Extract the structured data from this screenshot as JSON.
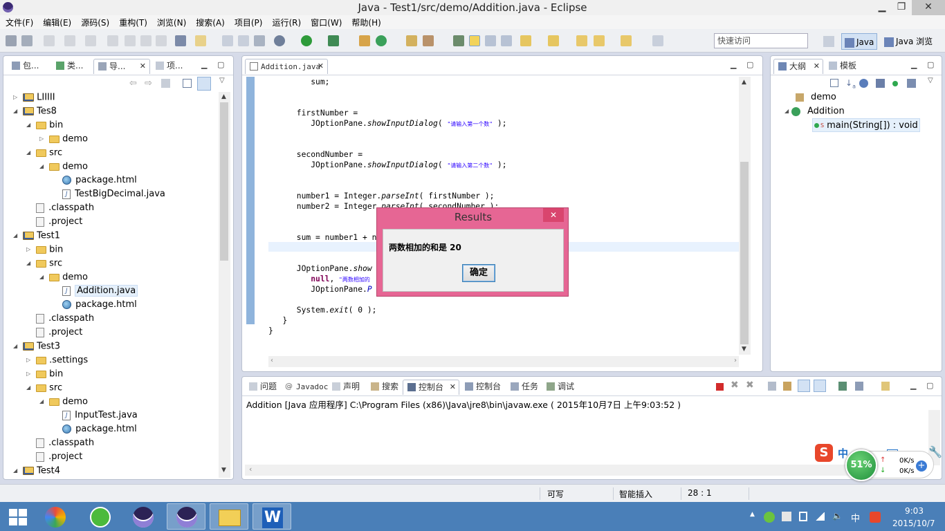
{
  "window": {
    "title": "Java  -  Test1/src/demo/Addition.java  -  Eclipse"
  },
  "menu": [
    "文件(F)",
    "编辑(E)",
    "源码(S)",
    "重构(T)",
    "浏览(N)",
    "搜索(A)",
    "项目(P)",
    "运行(R)",
    "窗口(W)",
    "帮助(H)"
  ],
  "quick_access": {
    "placeholder": "快速访问"
  },
  "perspectives": {
    "java": "Java",
    "java_browse": "Java 浏览"
  },
  "left_panel": {
    "tabs": [
      "包...",
      "类...",
      "导...",
      "项..."
    ]
  },
  "tree": [
    {
      "label": "LIIIII",
      "arrow": "▷",
      "icon": "proj",
      "depth": 0
    },
    {
      "label": "Tes8",
      "arrow": "◢",
      "icon": "proj",
      "depth": 0
    },
    {
      "label": "bin",
      "arrow": "◢",
      "icon": "fold",
      "depth": 1
    },
    {
      "label": "demo",
      "arrow": "▷",
      "icon": "fold",
      "depth": 2
    },
    {
      "label": "src",
      "arrow": "◢",
      "icon": "fold",
      "depth": 1
    },
    {
      "label": "demo",
      "arrow": "◢",
      "icon": "fold",
      "depth": 2
    },
    {
      "label": "package.html",
      "arrow": "",
      "icon": "globe",
      "depth": 3
    },
    {
      "label": "TestBigDecimal.java",
      "arrow": "",
      "icon": "jfile",
      "depth": 3
    },
    {
      "label": ".classpath",
      "arrow": "",
      "icon": "cfile",
      "depth": 1
    },
    {
      "label": ".project",
      "arrow": "",
      "icon": "cfile",
      "depth": 1
    },
    {
      "label": "Test1",
      "arrow": "◢",
      "icon": "proj",
      "depth": 0
    },
    {
      "label": "bin",
      "arrow": "▷",
      "icon": "fold",
      "depth": 1
    },
    {
      "label": "src",
      "arrow": "◢",
      "icon": "fold",
      "depth": 1
    },
    {
      "label": "demo",
      "arrow": "◢",
      "icon": "fold",
      "depth": 2
    },
    {
      "label": "Addition.java",
      "arrow": "",
      "icon": "jfile",
      "depth": 3,
      "selected": true
    },
    {
      "label": "package.html",
      "arrow": "",
      "icon": "globe",
      "depth": 3
    },
    {
      "label": ".classpath",
      "arrow": "",
      "icon": "cfile",
      "depth": 1
    },
    {
      "label": ".project",
      "arrow": "",
      "icon": "cfile",
      "depth": 1
    },
    {
      "label": "Test3",
      "arrow": "◢",
      "icon": "proj",
      "depth": 0
    },
    {
      "label": ".settings",
      "arrow": "▷",
      "icon": "fold",
      "depth": 1
    },
    {
      "label": "bin",
      "arrow": "▷",
      "icon": "fold",
      "depth": 1
    },
    {
      "label": "src",
      "arrow": "◢",
      "icon": "fold",
      "depth": 1
    },
    {
      "label": "demo",
      "arrow": "◢",
      "icon": "fold",
      "depth": 2
    },
    {
      "label": "InputTest.java",
      "arrow": "",
      "icon": "jfile",
      "depth": 3
    },
    {
      "label": "package.html",
      "arrow": "",
      "icon": "globe",
      "depth": 3
    },
    {
      "label": ".classpath",
      "arrow": "",
      "icon": "cfile",
      "depth": 1
    },
    {
      "label": ".project",
      "arrow": "",
      "icon": "cfile",
      "depth": 1
    },
    {
      "label": "Test4",
      "arrow": "◢",
      "icon": "proj",
      "depth": 0
    }
  ],
  "editor": {
    "tab": "Addition.java",
    "lines": [
      {
        "html": "         sum;"
      },
      {
        "html": ""
      },
      {
        "html": ""
      },
      {
        "html": "      firstNumber ="
      },
      {
        "html": "         JOptionPane.<i class=\"it\">showInputDialog</i>( <span class=\"str\">\"请输入第一个数\"</span> );"
      },
      {
        "html": ""
      },
      {
        "html": ""
      },
      {
        "html": "      secondNumber ="
      },
      {
        "html": "         JOptionPane.<i class=\"it\">showInputDialog</i>( <span class=\"str\">\"请输入第二个数\"</span> );"
      },
      {
        "html": ""
      },
      {
        "html": ""
      },
      {
        "html": "      number1 = Integer.<i class=\"it\">parseInt</i>( firstNumber );"
      },
      {
        "html": "      number2 = Integer.<i class=\"it\">parseInt</i>( secondNumber );"
      },
      {
        "html": ""
      },
      {
        "html": ""
      },
      {
        "html": "      sum = number1 + n"
      },
      {
        "html": ""
      },
      {
        "html": ""
      },
      {
        "html": "      JOptionPane.<i class=\"it\">show</i>"
      },
      {
        "html": "         <span class=\"kw\">null</span>, <span class=\"str\">\"两数相加的</span>"
      },
      {
        "html": "         JOptionPane.<span class=\"fld\">P</span>"
      },
      {
        "html": ""
      },
      {
        "html": "      System.<i class=\"it\">exit</i>( 0 );"
      },
      {
        "html": "   }"
      },
      {
        "html": "}"
      }
    ]
  },
  "outline": {
    "tabs": [
      "大纲",
      "模板"
    ],
    "items": [
      {
        "label": "demo"
      },
      {
        "label": "Addition"
      },
      {
        "label": "main(String[]) : void"
      }
    ]
  },
  "bottom": {
    "tabs": [
      "问题",
      "Javadoc",
      "声明",
      "搜索",
      "控制台",
      "控制台",
      "任务",
      "调试"
    ],
    "console_header": "Addition [Java 应用程序] C:\\Program Files (x86)\\Java\\jre8\\bin\\javaw.exe ( 2015年10月7日 上午9:03:52 )"
  },
  "dialog": {
    "title": "Results",
    "message": "两数相加的和是 20",
    "ok": "确定",
    "close": "✕"
  },
  "status": {
    "writable": "可写",
    "insert_mode": "智能插入",
    "position": "28 : 1"
  },
  "netmon": {
    "percent": "51%",
    "up": "0K/s",
    "down": "0K/s"
  },
  "ime": {
    "lang": "中"
  },
  "taskbar": {
    "time": "9:03",
    "date": "2015/10/7",
    "lang": "中"
  }
}
